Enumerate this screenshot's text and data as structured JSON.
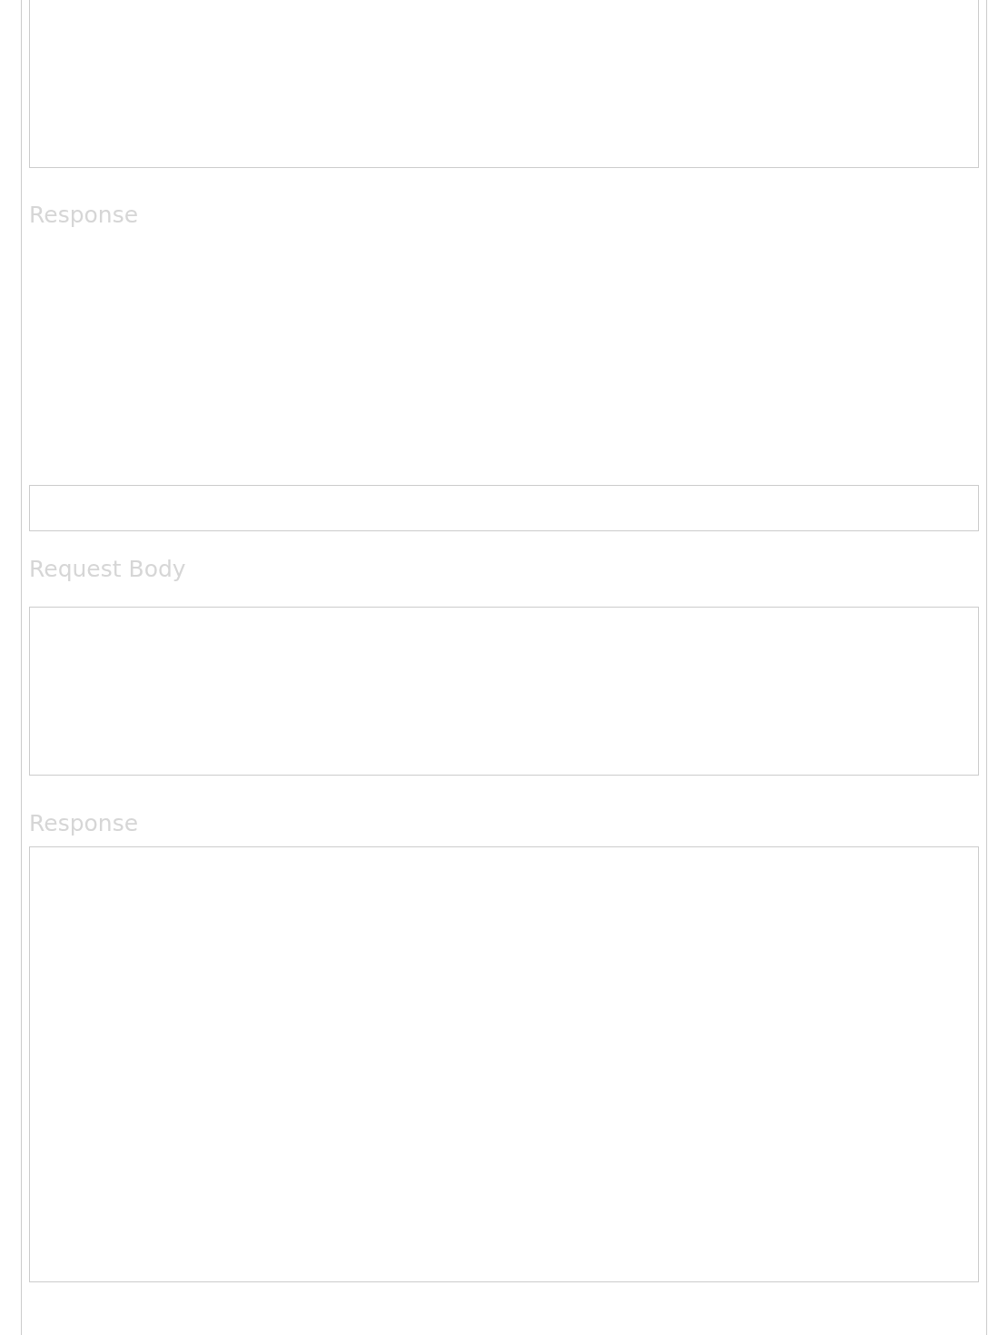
{
  "sections": [
    {
      "kind": "textarea"
    },
    {
      "kind": "heading",
      "text": "Response"
    },
    {
      "kind": "output"
    },
    {
      "kind": "input"
    },
    {
      "kind": "heading",
      "text": "Request Body"
    },
    {
      "kind": "textarea"
    },
    {
      "kind": "heading",
      "text": "Response"
    },
    {
      "kind": "result"
    }
  ]
}
